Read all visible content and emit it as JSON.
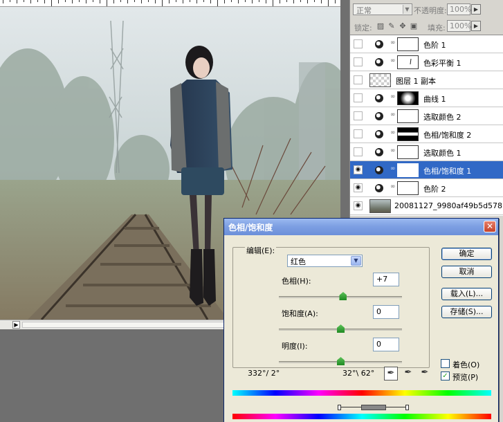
{
  "colors": {
    "selection": "#3169c6",
    "titlebar": "#7ea0e3",
    "slider_thumb": "#1f8a22"
  },
  "layers_panel": {
    "blend_mode": "正常",
    "opacity_label": "不透明度:",
    "opacity_value": "100%",
    "lock_label": "锁定:",
    "fill_label": "填充:",
    "fill_value": "100%",
    "layers": [
      {
        "name": "色阶 1",
        "visible": false,
        "type": "adjustment",
        "selected": false
      },
      {
        "name": "色彩平衡 1",
        "visible": false,
        "type": "adjustment",
        "selected": false
      },
      {
        "name": "图层 1 副本",
        "visible": false,
        "type": "pixel-transparent",
        "selected": false
      },
      {
        "name": "曲线 1",
        "visible": false,
        "type": "adjustment",
        "selected": false
      },
      {
        "name": "选取颜色 2",
        "visible": false,
        "type": "adjustment",
        "selected": false
      },
      {
        "name": "色相/饱和度 2",
        "visible": false,
        "type": "adjustment",
        "selected": false
      },
      {
        "name": "选取颜色 1",
        "visible": false,
        "type": "adjustment",
        "selected": false
      },
      {
        "name": "色相/饱和度 1",
        "visible": true,
        "type": "adjustment",
        "selected": true
      },
      {
        "name": "色阶 2",
        "visible": true,
        "type": "adjustment",
        "selected": false
      },
      {
        "name": "20081127_9980af49b5d578...",
        "visible": true,
        "type": "background",
        "selected": false
      }
    ]
  },
  "dialog": {
    "title": "色相/饱和度",
    "edit_label": "编辑(E):",
    "edit_value": "红色",
    "hue": {
      "label": "色相(H):",
      "value": "+7",
      "min": -180,
      "max": 180,
      "current": 7
    },
    "saturation": {
      "label": "饱和度(A):",
      "value": "0",
      "min": -100,
      "max": 100,
      "current": 0
    },
    "lightness": {
      "label": "明度(I):",
      "value": "0",
      "min": -100,
      "max": 100,
      "current": 0
    },
    "buttons": {
      "ok": "确定",
      "cancel": "取消",
      "load": "载入(L)...",
      "save": "存储(S)..."
    },
    "colorize": {
      "label": "着色(O)",
      "checked": false
    },
    "preview": {
      "label": "预览(P)",
      "checked": true
    },
    "range_left": "332°/ 2°",
    "range_right": "32°\\ 62°",
    "checkmark": "✓"
  }
}
